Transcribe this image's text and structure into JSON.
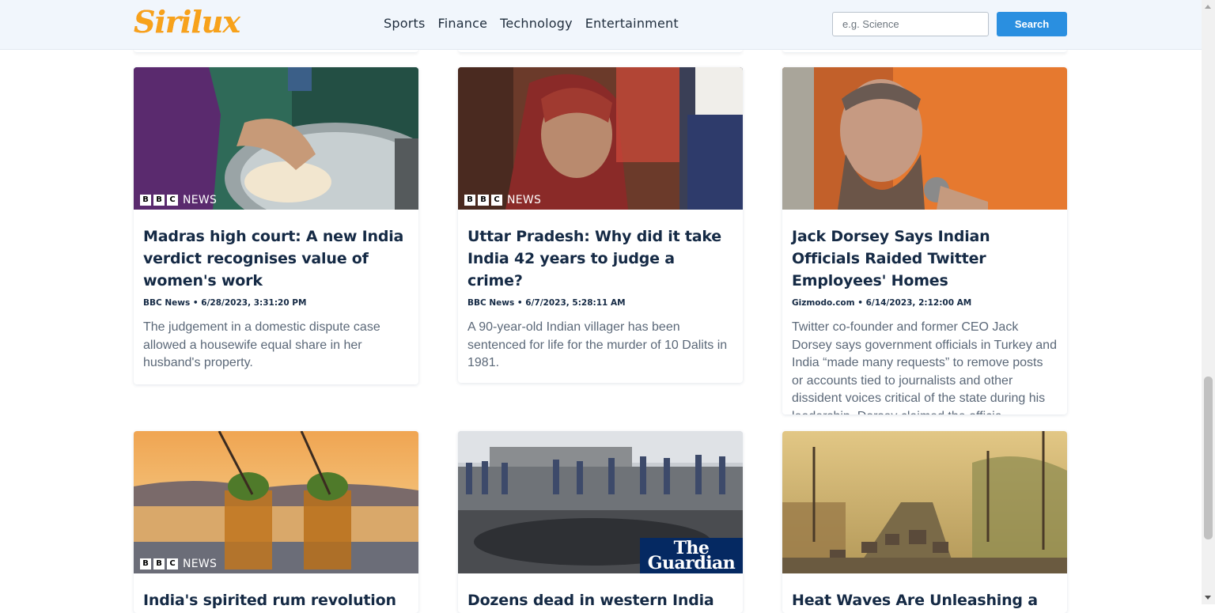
{
  "brand": {
    "logo_text": "Sirilux",
    "accent": "#2a8fe0"
  },
  "nav": {
    "links": [
      "Sports",
      "Finance",
      "Technology",
      "Entertainment"
    ]
  },
  "search": {
    "placeholder": "e.g. Science",
    "button_label": "Search"
  },
  "articles": [
    {
      "title": "Madras high court: A new India verdict recognises value of women's work",
      "source": "BBC News",
      "date": "6/28/2023, 3:31:20 PM",
      "description": "The judgement in a domestic dispute case allowed a housewife equal share in her husband's property.",
      "badge": "bbc"
    },
    {
      "title": "Uttar Pradesh: Why did it take India 42 years to judge a crime?",
      "source": "BBC News",
      "date": "6/7/2023, 5:28:11 AM",
      "description": "A 90-year-old Indian villager has been sentenced for life for the murder of 10 Dalits in 1981.",
      "badge": "bbc"
    },
    {
      "title": "Jack Dorsey Says Indian Officials Raided Twitter Employees' Homes",
      "source": "Gizmodo.com",
      "date": "6/14/2023, 2:12:00 AM",
      "description": "Twitter co-founder and former CEO Jack Dorsey says government officials in Turkey and India “made many requests” to remove posts or accounts tied to journalists and other dissident voices critical of the state during his leadership. Dorsey claimed the officia…",
      "badge": "none"
    },
    {
      "title": "India's spirited rum revolution",
      "badge": "bbc"
    },
    {
      "title": "Dozens dead in western India bus",
      "badge": "guardian"
    },
    {
      "title": "Heat Waves Are Unleashing a",
      "badge": "none"
    }
  ],
  "badges": {
    "bbc_letters": [
      "B",
      "B",
      "C"
    ],
    "bbc_news": "NEWS",
    "guardian_line1": "The",
    "guardian_line2": "Guardian"
  }
}
